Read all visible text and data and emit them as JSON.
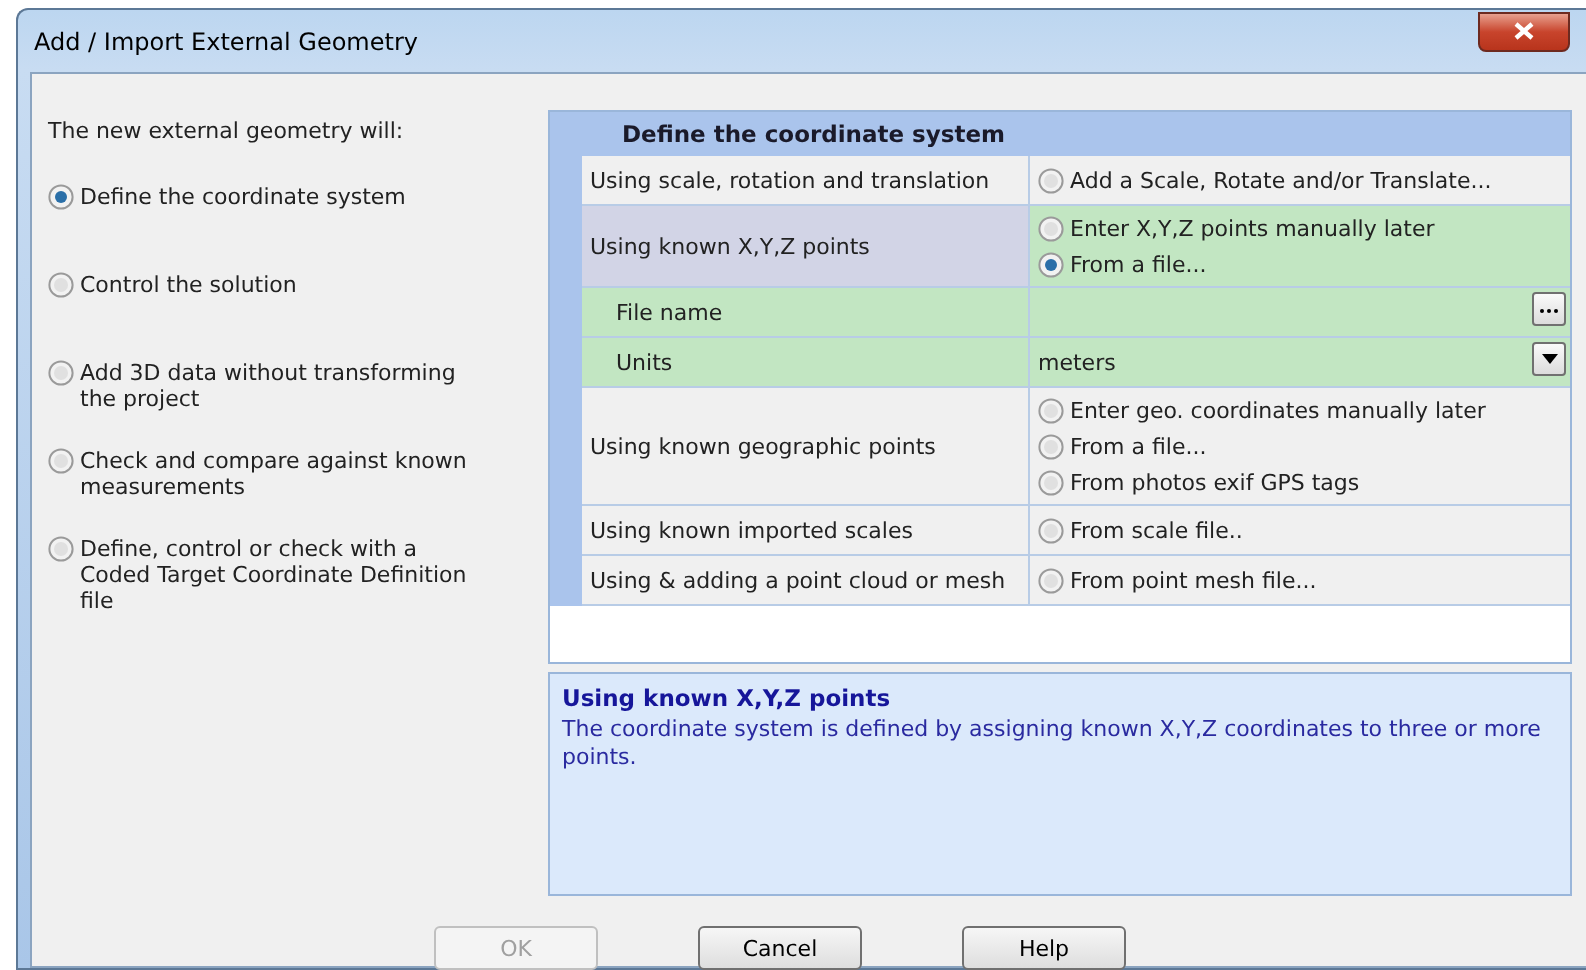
{
  "window": {
    "title": "Add / Import External Geometry"
  },
  "intro": "The new external geometry will:",
  "choices": [
    {
      "label": "Define the coordinate system",
      "selected": true
    },
    {
      "label": "Control the solution",
      "selected": false
    },
    {
      "label": "Add 3D data without transforming the project",
      "selected": false
    },
    {
      "label": "Check and compare against known measurements",
      "selected": false
    },
    {
      "label": "Define, control or check with a Coded Target Coordinate Definition file",
      "selected": false
    }
  ],
  "grid": {
    "heading": "Define the coordinate system",
    "rows": [
      {
        "kind": "options",
        "label": "Using scale, rotation and translation",
        "highlighted": false,
        "options": [
          {
            "label": "Add a Scale, Rotate and/or Translate...",
            "selected": false
          }
        ]
      },
      {
        "kind": "options",
        "label": "Using known X,Y,Z points",
        "highlighted": true,
        "options": [
          {
            "label": "Enter X,Y,Z points manually later",
            "selected": false
          },
          {
            "label": "From a file...",
            "selected": true
          }
        ]
      },
      {
        "kind": "file",
        "label": "File name",
        "highlighted": true
      },
      {
        "kind": "dropdown",
        "label": "Units",
        "value": "meters",
        "highlighted": true
      },
      {
        "kind": "options",
        "label": "Using known geographic points",
        "highlighted": false,
        "options": [
          {
            "label": "Enter geo. coordinates manually later",
            "selected": false
          },
          {
            "label": "From a file...",
            "selected": false
          },
          {
            "label": "From photos exif GPS tags",
            "selected": false
          }
        ]
      },
      {
        "kind": "options",
        "label": "Using known imported scales",
        "highlighted": false,
        "options": [
          {
            "label": "From scale file..",
            "selected": false
          }
        ]
      },
      {
        "kind": "options",
        "label": "Using & adding a point cloud or mesh",
        "highlighted": false,
        "options": [
          {
            "label": "From point mesh file...",
            "selected": false
          }
        ]
      }
    ]
  },
  "description": {
    "title": "Using known X,Y,Z points",
    "text": "The coordinate system is defined by assigning known X,Y,Z coordinates to three or more points."
  },
  "buttons": [
    {
      "label": "OK",
      "disabled": true
    },
    {
      "label": "Cancel",
      "disabled": false
    },
    {
      "label": "Help",
      "disabled": false
    }
  ]
}
